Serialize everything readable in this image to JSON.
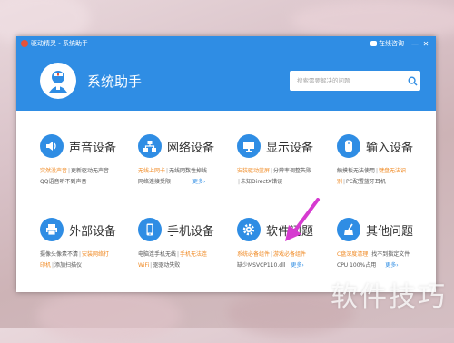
{
  "window": {
    "title": "驱动精灵 - 系统助手",
    "consult_label": "在线咨询",
    "min_glyph": "—",
    "close_glyph": "✕"
  },
  "header": {
    "title": "系统助手",
    "search_placeholder": "搜索需要解决的问题"
  },
  "cards": [
    {
      "title": "声音设备",
      "icon": "speaker-icon",
      "l1a": "突然没声音",
      "l1b": "更新驱动无声音",
      "l2a": "QQ语音听不到声音",
      "l2b": "",
      "more": "更多›"
    },
    {
      "title": "网络设备",
      "icon": "network-icon",
      "l1a": "无线上网卡",
      "l1b": "无线网数性掉线",
      "l2a": "网络连接受限",
      "l2b": "",
      "more": "更多›"
    },
    {
      "title": "显示设备",
      "icon": "monitor-icon",
      "l1a": "安装驱动蓝屏",
      "l1b": "分辨率调整失败",
      "l2a": "",
      "l2b": "未知DirectX错误",
      "more": "更多›"
    },
    {
      "title": "输入设备",
      "icon": "keyboard-icon",
      "l1a": "触摸板无法使用",
      "l1b": "键盘无法识",
      "l2a": "别",
      "l2b": "PC配置蓝牙耳机",
      "more": "更多›"
    },
    {
      "title": "外部设备",
      "icon": "printer-icon",
      "l1a": "摄像头像素不清",
      "l1b": "安装网络打",
      "l2a": "印机",
      "l2b": "添加扫描仪",
      "more": "更多›"
    },
    {
      "title": "手机设备",
      "icon": "phone-icon",
      "l1a": "电脑连手机无线",
      "l1b": "手机无法连",
      "l2a": "WiFi",
      "l2b": "驱驱动失败",
      "more": "更多›"
    },
    {
      "title": "软件问题",
      "icon": "gear-icon",
      "l1a": "系统必备组件",
      "l1b": "游戏必备组件",
      "l2a": "",
      "l2b": "缺少MSVCP110.dll",
      "more": "更多›"
    },
    {
      "title": "其他问题",
      "icon": "broom-icon",
      "l1a": "C盘深度清理",
      "l1b": "找不到指定文件",
      "l2a": "",
      "l2b": "CPU 100%占用",
      "more": "更多›"
    }
  ],
  "watermark": "软件技巧",
  "colors": {
    "brand_blue": "#2f8de4",
    "link_orange": "#f08a24",
    "arrow_magenta": "#d63ad0"
  }
}
